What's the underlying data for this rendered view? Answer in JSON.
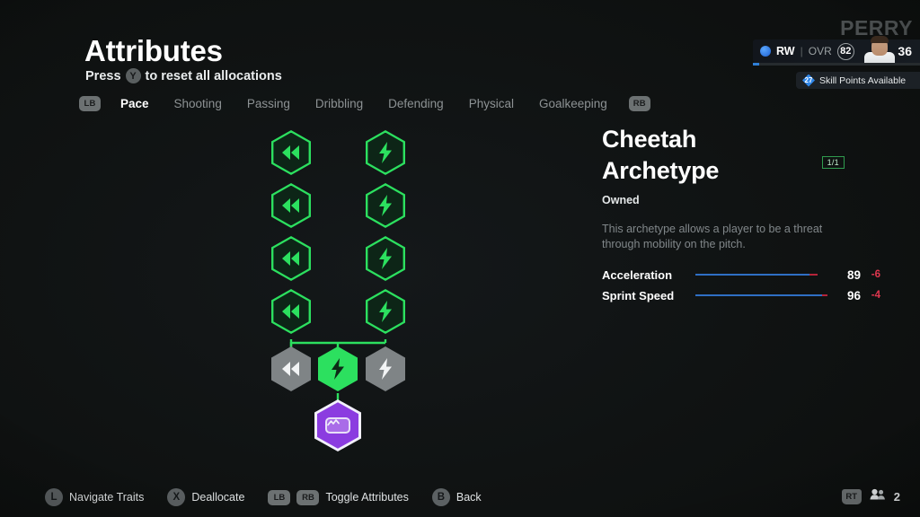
{
  "header": {
    "title": "Attributes",
    "subtitle_prefix": "Press",
    "subtitle_button": "Y",
    "subtitle_suffix": "to reset all allocations"
  },
  "tabs": {
    "left_bumper": "LB",
    "right_bumper": "RB",
    "items": [
      {
        "label": "Pace",
        "active": true
      },
      {
        "label": "Shooting",
        "active": false
      },
      {
        "label": "Passing",
        "active": false
      },
      {
        "label": "Dribbling",
        "active": false
      },
      {
        "label": "Defending",
        "active": false
      },
      {
        "label": "Physical",
        "active": false
      },
      {
        "label": "Goalkeeping",
        "active": false
      }
    ]
  },
  "player": {
    "name": "PERRY",
    "position": "RW",
    "divider": "|",
    "ovr_label": "OVR",
    "ovr_value": "82",
    "age": "36",
    "skill_points_value": "27",
    "skill_points_label": "Skill Points Available",
    "progress_percent": 4
  },
  "tree": {
    "nodes": [
      {
        "id": "accel-1",
        "icon": "rewind-icon",
        "state": "green"
      },
      {
        "id": "accel-2",
        "icon": "rewind-icon",
        "state": "green"
      },
      {
        "id": "accel-3",
        "icon": "rewind-icon",
        "state": "green"
      },
      {
        "id": "accel-4",
        "icon": "rewind-icon",
        "state": "green"
      },
      {
        "id": "sprint-1",
        "icon": "lightning-icon",
        "state": "green"
      },
      {
        "id": "sprint-2",
        "icon": "lightning-icon",
        "state": "green"
      },
      {
        "id": "sprint-3",
        "icon": "lightning-icon",
        "state": "green"
      },
      {
        "id": "sprint-4",
        "icon": "lightning-icon",
        "state": "green"
      },
      {
        "id": "base-left",
        "icon": "rewind-icon",
        "state": "gray"
      },
      {
        "id": "base-center",
        "icon": "lightning-icon",
        "state": "solidgreen"
      },
      {
        "id": "base-right",
        "icon": "lightning-icon",
        "state": "gray"
      },
      {
        "id": "playstyle",
        "icon": "playstyle-card-icon",
        "state": "purple"
      }
    ]
  },
  "detail": {
    "title_line1": "Cheetah",
    "title_line2": "Archetype",
    "count_badge": "1/1",
    "owned_label": "Owned",
    "description": "This archetype allows a player to be a threat through mobility on the pitch.",
    "stats": [
      {
        "name": "Acceleration",
        "value": "89",
        "delta": "-6",
        "fill_percent": 89,
        "red_percent": 6
      },
      {
        "name": "Sprint Speed",
        "value": "96",
        "delta": "-4",
        "fill_percent": 96,
        "red_percent": 4
      }
    ]
  },
  "footer": {
    "actions": [
      {
        "glyph": "L",
        "glyph_type": "round",
        "label": "Navigate Traits"
      },
      {
        "glyph": "X",
        "glyph_type": "round",
        "label": "Deallocate"
      },
      {
        "glyph": "LB",
        "glyph2": "RB",
        "glyph_type": "bumper-pair",
        "label": "Toggle Attributes"
      },
      {
        "glyph": "B",
        "glyph_type": "round",
        "label": "Back"
      }
    ],
    "right_badge": "RT",
    "right_count": "2"
  },
  "colors": {
    "accent_green": "#2ce05f",
    "purple": "#8b3ce0",
    "stat_blue": "#2f6fc4",
    "stat_red": "#e0374f",
    "bumper_gray": "#6c7172"
  }
}
